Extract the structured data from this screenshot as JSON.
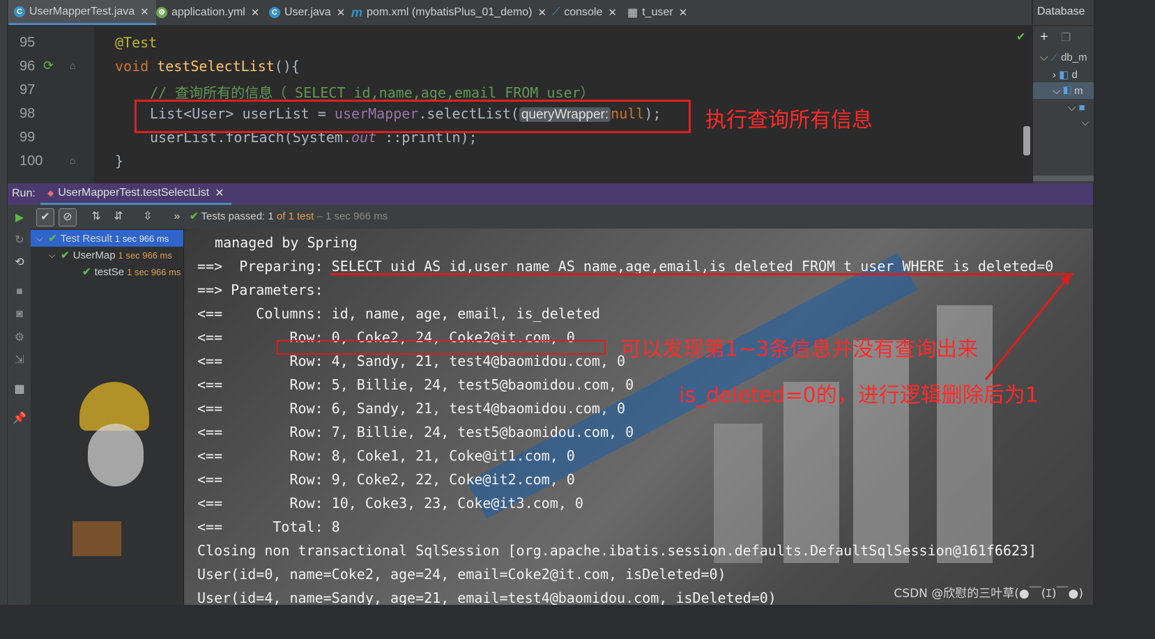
{
  "tabs": [
    {
      "label": "UserMapperTest.java",
      "icon": "java-class-icon",
      "active": true
    },
    {
      "label": "application.yml",
      "icon": "spring-config-icon"
    },
    {
      "label": "User.java",
      "icon": "java-class-icon"
    },
    {
      "label": "pom.xml (mybatisPlus_01_demo)",
      "icon": "maven-icon"
    },
    {
      "label": "console",
      "icon": "db-console-icon"
    },
    {
      "label": "t_user",
      "icon": "table-icon"
    }
  ],
  "database_panel": {
    "title": "Database",
    "tree": [
      "db_m",
      "d",
      "m"
    ]
  },
  "editor": {
    "lines": [
      {
        "num": "95",
        "annotation": "@Test"
      },
      {
        "num": "96",
        "keyword": "void",
        "method": "testSelectList",
        "rest": "(){"
      },
      {
        "num": "97",
        "comment": "// 查询所有的信息（ SELECT id,name,age,email FROM user）"
      },
      {
        "num": "98",
        "pre": "List<User> userList = ",
        "field": "userMapper",
        "call": ".selectList(",
        "hint": "queryWrapper:",
        "null": "null",
        "post": ");"
      },
      {
        "num": "99",
        "pre": "userList.forEach(System.",
        "italic": "out",
        "post": " ::println);"
      },
      {
        "num": "100",
        "code": "}"
      }
    ],
    "annotation_text": "执行查询所有信息"
  },
  "run": {
    "label": "Run:",
    "tab": "UserMapperTest.testSelectList",
    "status_pass": "Tests passed: 1",
    "status_of": "of 1 test",
    "status_time": "– 1 sec 966 ms"
  },
  "tree": [
    {
      "label": "Test Result",
      "duration": "1 sec 966 ms"
    },
    {
      "label": "UserMap",
      "duration": "1 sec 966 ms"
    },
    {
      "label": "testSe",
      "duration": "1 sec 966 ms"
    }
  ],
  "console": {
    "lines": [
      " managed by Spring",
      "==>  Preparing: SELECT uid AS id,user_name AS name,age,email,is_deleted FROM t_user WHERE is_deleted=0",
      "==> Parameters: ",
      "<==    Columns: id, name, age, email, is_deleted",
      "<==        Row: 0, Coke2, 24, Coke2@it.com, 0",
      "<==        Row: 4, Sandy, 21, test4@baomidou.com, 0",
      "<==        Row: 5, Billie, 24, test5@baomidou.com, 0",
      "<==        Row: 6, Sandy, 21, test4@baomidou.com, 0",
      "<==        Row: 7, Billie, 24, test5@baomidou.com, 0",
      "<==        Row: 8, Coke1, 21, Coke@it1.com, 0",
      "<==        Row: 9, Coke2, 22, Coke@it2.com, 0",
      "<==        Row: 10, Coke3, 23, Coke@it3.com, 0",
      "<==      Total: 8",
      "Closing non transactional SqlSession [org.apache.ibatis.session.defaults.DefaultSqlSession@161f6623]",
      "User(id=0, name=Coke2, age=24, email=Coke2@it.com, isDeleted=0)",
      "User(id=4, name=Sandy, age=21, email=test4@baomidou.com, isDeleted=0)"
    ],
    "annotation_1": "可以发现第1~3条信息并没有查询出来",
    "annotation_2": "is_deleted=0的，进行逻辑删除后为1",
    "watermark": "CSDN @欣慰的三叶草(●￣(ｴ)￣●)"
  },
  "colors": {
    "annotation_red": "#ff2a2a",
    "accent": "#4a88c7",
    "pass_green": "#5fb84a",
    "run_bar": "#4b3a6e"
  }
}
